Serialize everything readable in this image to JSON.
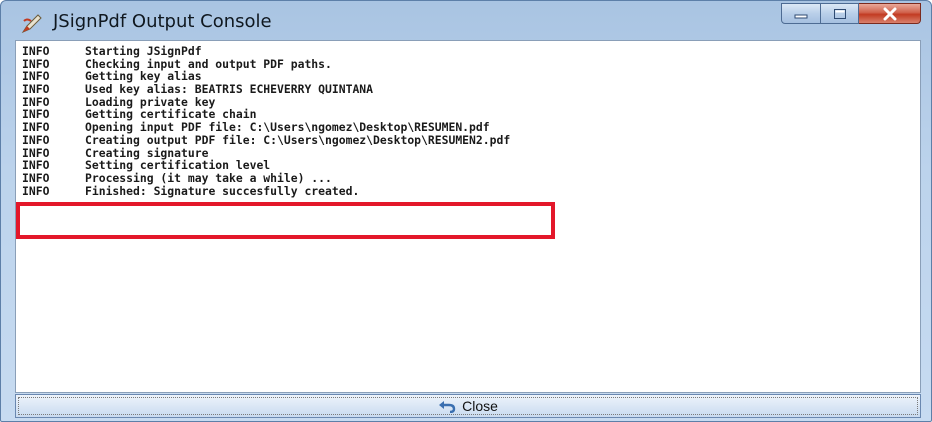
{
  "window": {
    "title": "JSignPdf Output Console",
    "accent": "#c7dbf1",
    "icons": {
      "app": "pen-icon",
      "minimize": "minimize-icon",
      "maximize": "maximize-icon",
      "close": "close-icon"
    }
  },
  "log": [
    {
      "level": "INFO",
      "message": "Starting JSignPdf"
    },
    {
      "level": "INFO",
      "message": "Checking input and output PDF paths."
    },
    {
      "level": "INFO",
      "message": "Getting key alias"
    },
    {
      "level": "INFO",
      "message": "Used key alias: BEATRIS ECHEVERRY QUINTANA"
    },
    {
      "level": "INFO",
      "message": "Loading private key"
    },
    {
      "level": "INFO",
      "message": "Getting certificate chain"
    },
    {
      "level": "INFO",
      "message": "Opening input PDF file: C:\\Users\\ngomez\\Desktop\\RESUMEN.pdf"
    },
    {
      "level": "INFO",
      "message": "Creating output PDF file: C:\\Users\\ngomez\\Desktop\\RESUMEN2.pdf"
    },
    {
      "level": "INFO",
      "message": "Creating signature"
    },
    {
      "level": "INFO",
      "message": "Setting certification level"
    },
    {
      "level": "INFO",
      "message": "Processing (it may take a while) ..."
    },
    {
      "level": "INFO",
      "message": "Finished: Signature succesfully created."
    }
  ],
  "highlight_color": "#e3172a",
  "close_button": {
    "label": "Close",
    "icon": "undo-arrow-icon"
  }
}
